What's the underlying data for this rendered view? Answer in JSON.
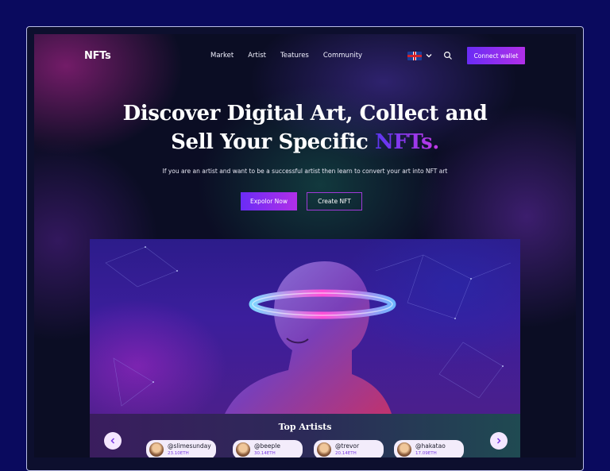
{
  "logo": "NFTs",
  "nav": [
    "Market",
    "Artist",
    "Teatures",
    "Community"
  ],
  "connect_label": "Connect wallet",
  "headline": {
    "line1": "Discover Digital Art, Collect and",
    "line2_prefix": "Sell Your Specific ",
    "line2_highlight": "NFTs."
  },
  "subtitle": "If you are an artist and want to be a successful artist then learn to convert your art into NFT art",
  "buttons": {
    "explore": "Expolor Now",
    "create": "Create NFT"
  },
  "top_artists": {
    "title": "Top Artists",
    "items": [
      {
        "name": "@slimesunday",
        "eth": "23.10ETH"
      },
      {
        "name": "@beeple",
        "eth": "30.14ETH"
      },
      {
        "name": "@trevor",
        "eth": "20.14ETH"
      },
      {
        "name": "@hakatao",
        "eth": "17.09ETH"
      }
    ]
  },
  "icons": {
    "flag": "uk-flag-icon",
    "language_chevron": "chevron-down-icon",
    "search": "search-icon",
    "prev": "chevron-left-icon",
    "next": "chevron-right-icon"
  },
  "colors": {
    "accent_start": "#6a2cf5",
    "accent_end": "#b12fe8",
    "outer_background": "#0a0a5e"
  }
}
